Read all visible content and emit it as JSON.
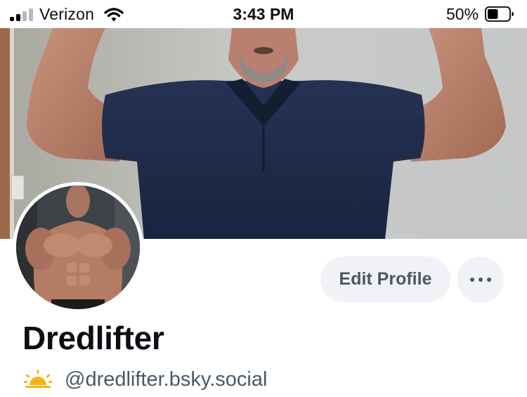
{
  "status_bar": {
    "carrier": "Verizon",
    "time": "3:43 PM",
    "battery_percent": "50%",
    "battery_level": 0.5,
    "signal_bars_active": 2,
    "signal_bars_total": 4
  },
  "profile": {
    "display_name": "Dredlifter",
    "handle": "@dredlifter.bsky.social",
    "edit_profile_label": "Edit Profile",
    "more_label": "More options"
  },
  "colors": {
    "button_bg": "#f0f2f5",
    "button_text": "#4a5866",
    "text_primary": "#0b0f14",
    "text_secondary": "#4a5866",
    "sun_icon": "#f5b517",
    "shirt": "#1f2a44"
  },
  "icons": {
    "signal": "cellular-signal-icon",
    "wifi": "wifi-icon",
    "battery": "battery-icon",
    "sun": "sun-icon",
    "more": "ellipsis-icon"
  }
}
